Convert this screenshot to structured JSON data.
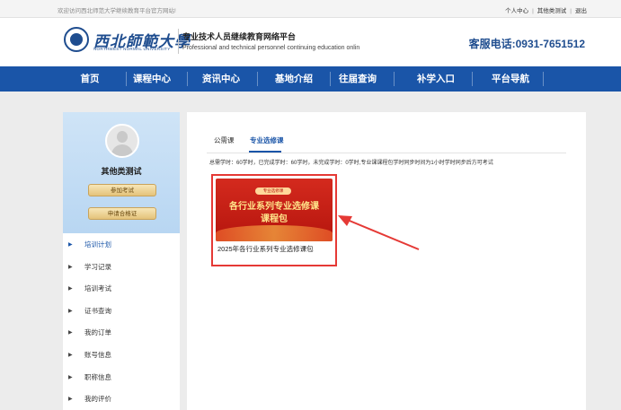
{
  "topbar": {
    "welcome": "欢迎访问西北师范大学继续教育平台官方网站!",
    "links": [
      "个人中心",
      "其他类测试",
      "退出"
    ]
  },
  "header": {
    "logo_cn": "西北師範大學",
    "logo_en": "NORTHWEST NORMAL UNIVERSITY",
    "platform_cn": "专业技术人员继续教育网络平台",
    "platform_en": "Professional and technical personnel continuing education onlin",
    "hotline": "客服电话:0931-7651512"
  },
  "nav": {
    "items": [
      "首页",
      "课程中心",
      "资讯中心",
      "基地介绍",
      "往届查询",
      "补学入口",
      "平台导航"
    ]
  },
  "sidebar": {
    "username": "其他类测试",
    "buttons": [
      "参加考试",
      "申请合格证"
    ],
    "menu": [
      "培训计划",
      "学习记录",
      "培训考试",
      "证书查询",
      "我的订单",
      "账号信息",
      "职称信息",
      "我的评价"
    ],
    "active_index": 0
  },
  "main": {
    "tabs": [
      "公需课",
      "专业选修课"
    ],
    "active_tab": 1,
    "summary": "总需学时：60学时，已完成学时：60学时，未完成学时：0学时,专业课课程包学时同步时间为1小时学时同步后方可考试",
    "course": {
      "badge": "专业选修课",
      "cover_line1": "各行业系列专业选修课",
      "cover_line2": "课程包",
      "name": "2025年各行业系列专业选修课包"
    }
  },
  "colors": {
    "nav_blue": "#1a55a8",
    "highlight_red": "#e53935"
  }
}
